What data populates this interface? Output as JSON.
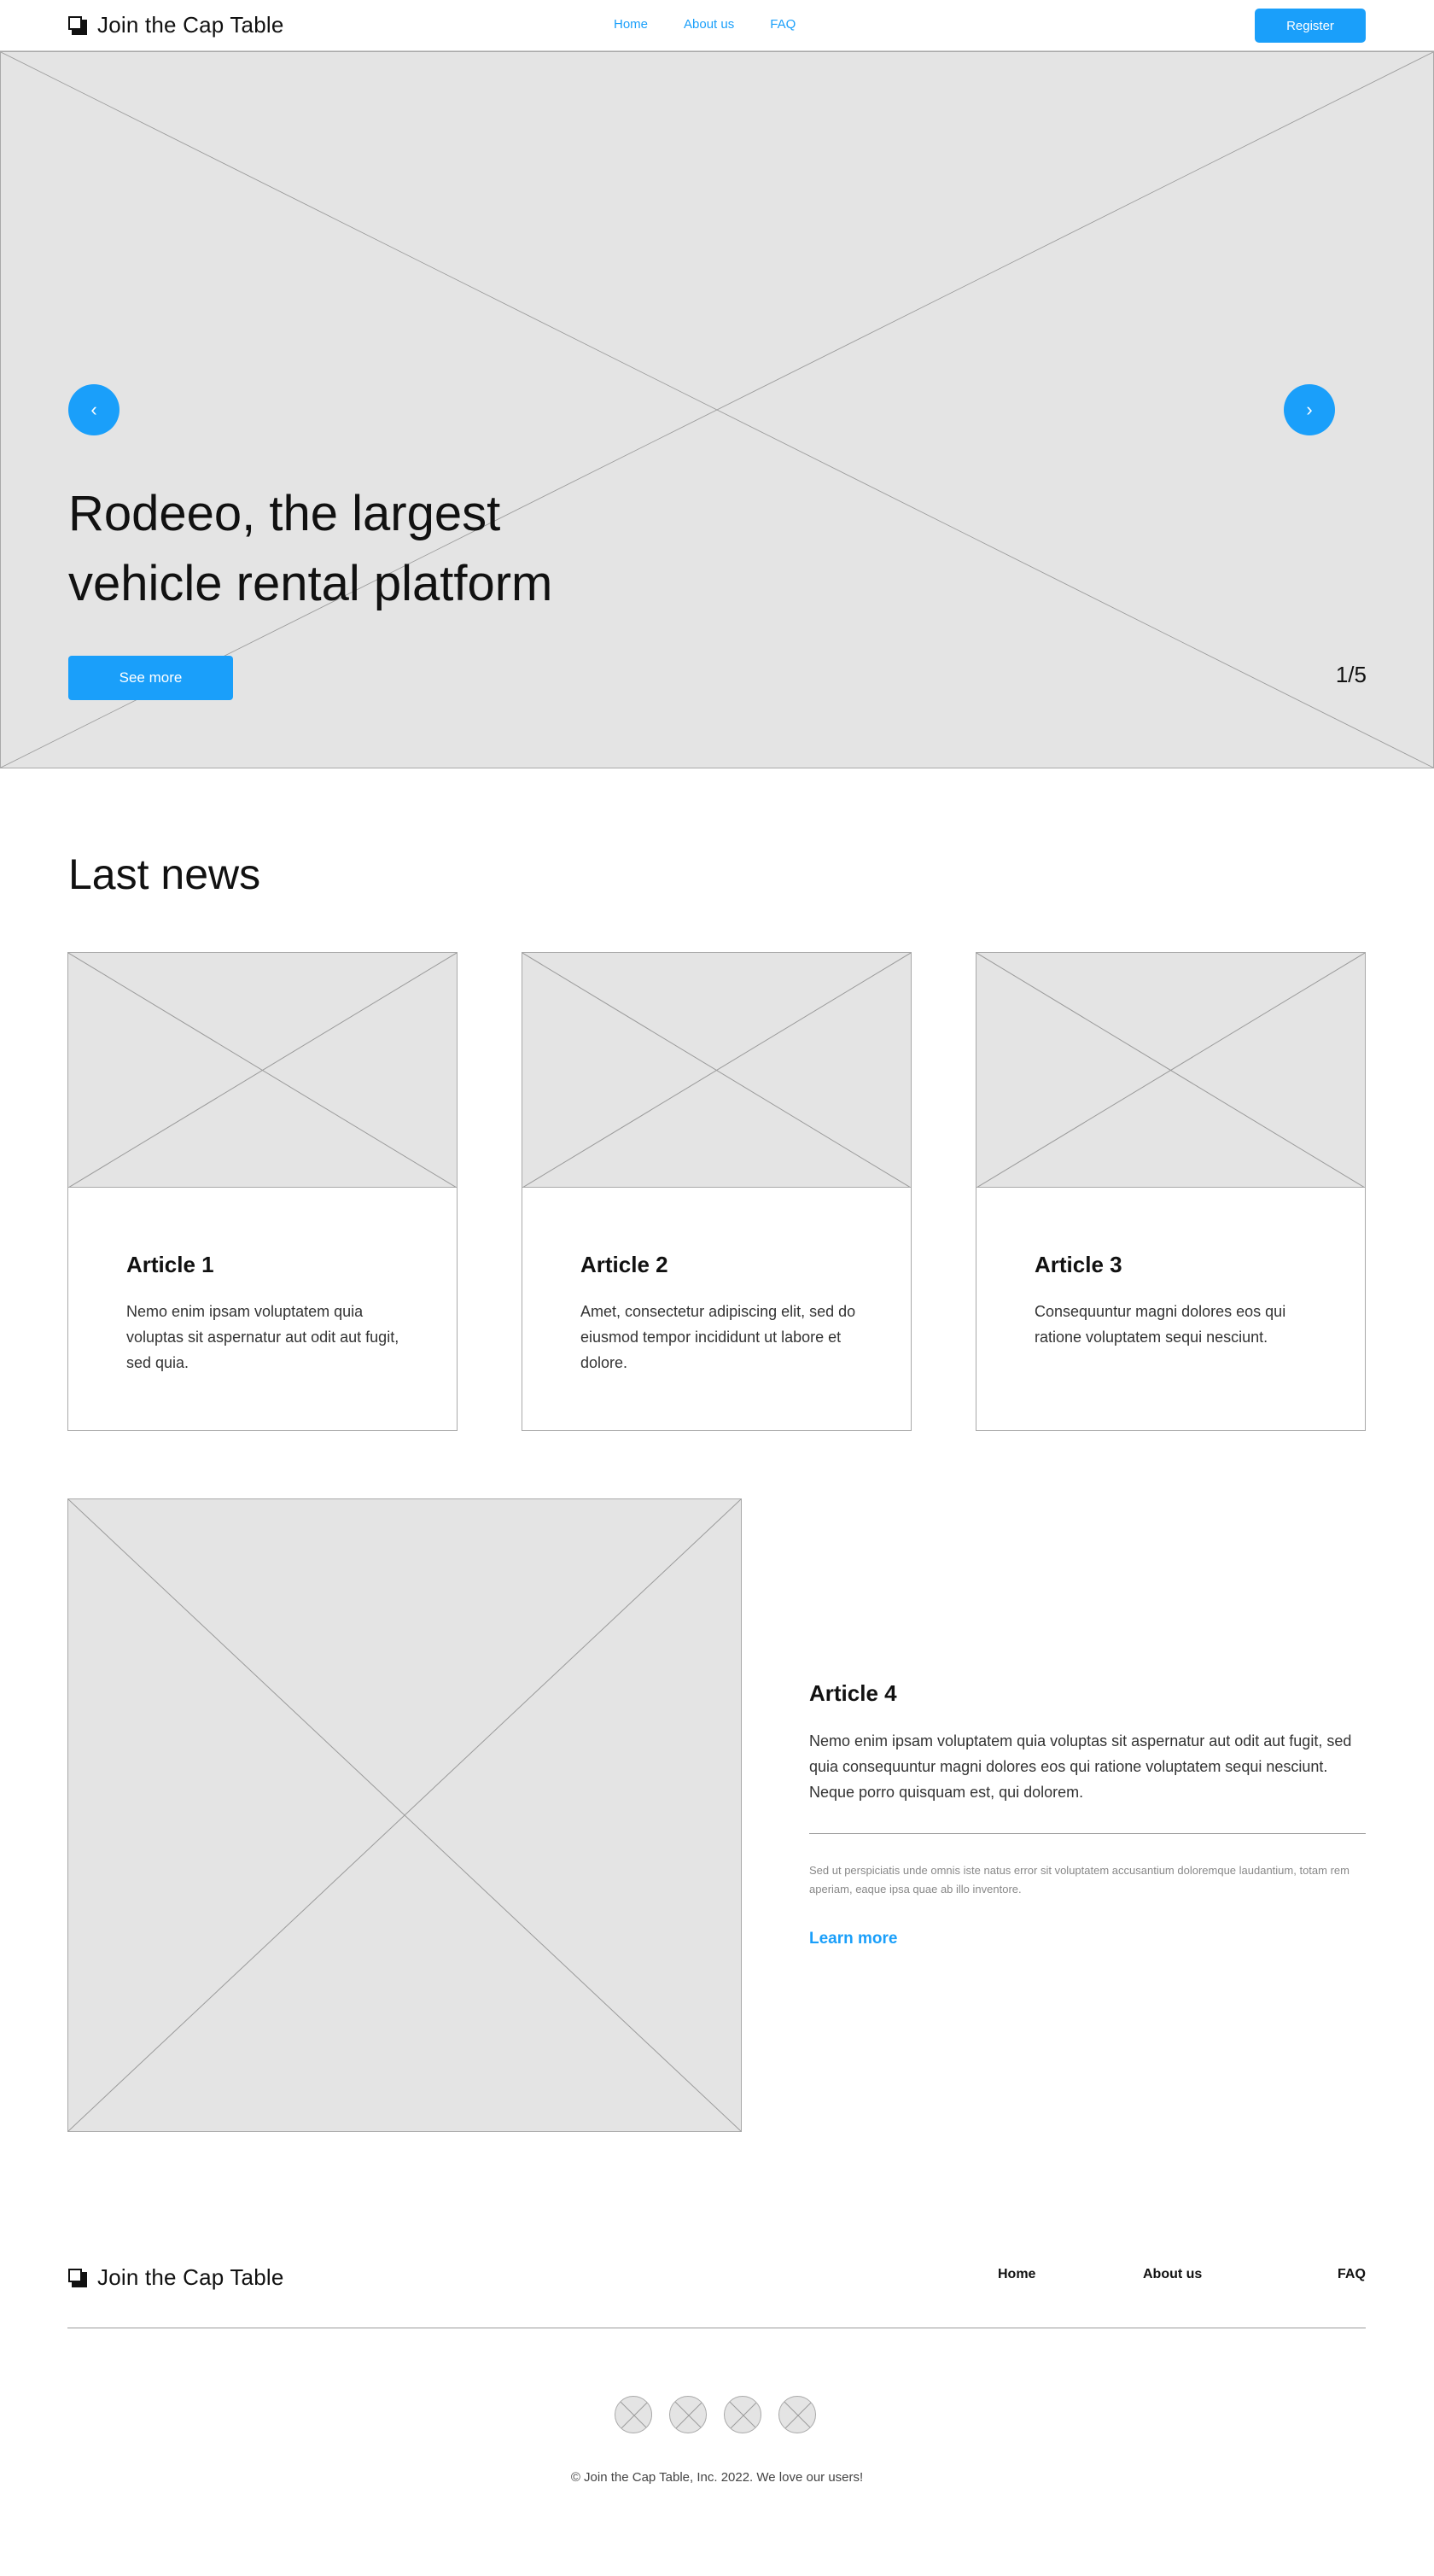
{
  "header": {
    "logo_text": "Join the Cap Table",
    "nav": [
      "Home",
      "About us",
      "FAQ"
    ],
    "register_label": "Register"
  },
  "hero": {
    "title": "Rodeeo, the largest vehicle rental platform",
    "cta_label": "See more",
    "counter": "1/5",
    "prev_icon": "chevron-left-icon",
    "next_icon": "chevron-right-icon"
  },
  "news": {
    "title": "Last news",
    "articles": [
      {
        "title": "Article 1",
        "text": "Nemo enim ipsam voluptatem quia voluptas sit aspernatur aut odit aut fugit, sed quia."
      },
      {
        "title": "Article 2",
        "text": "Amet, consectetur adipiscing elit, sed do eiusmod tempor incididunt ut labore et dolore."
      },
      {
        "title": "Article 3",
        "text": "Consequuntur magni dolores eos qui ratione voluptatem sequi nesciunt."
      }
    ]
  },
  "feature": {
    "title": "Article 4",
    "text": "Nemo enim ipsam voluptatem quia voluptas sit aspernatur aut odit aut fugit, sed quia consequuntur magni dolores eos qui ratione voluptatem sequi nesciunt. Neque porro quisquam est, qui dolorem.",
    "small_text": "Sed ut perspiciatis unde omnis iste natus error sit voluptatem accusantium doloremque laudantium, totam rem aperiam, eaque ipsa quae ab illo inventore.",
    "link_label": "Learn more"
  },
  "footer": {
    "logo_text": "Join the Cap Table",
    "nav": [
      "Home",
      "About us",
      "FAQ"
    ],
    "social_icons": [
      "social-icon-1",
      "social-icon-2",
      "social-icon-3",
      "social-icon-4"
    ],
    "copyright": "© Join the Cap Table, Inc. 2022. We love our users!"
  },
  "colors": {
    "accent": "#1a9ffa",
    "placeholder": "#e4e4e4",
    "border": "#a9a9a9"
  }
}
